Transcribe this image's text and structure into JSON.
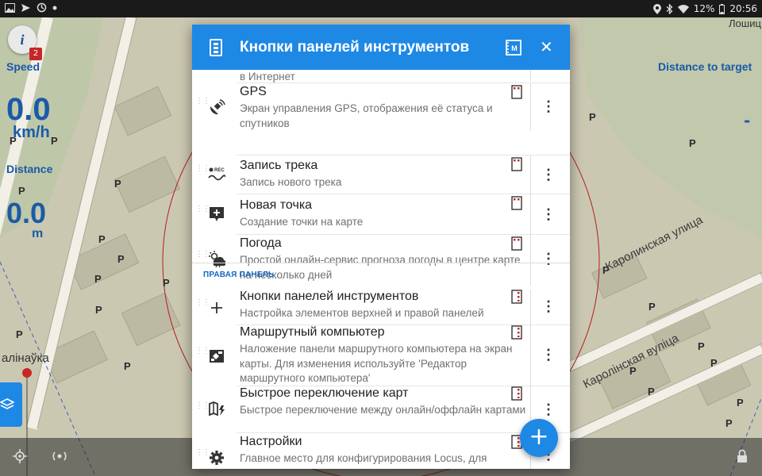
{
  "status_bar": {
    "left_icons": [
      "image-icon",
      "send-icon",
      "sync-icon",
      "dot-icon"
    ],
    "battery": "12%",
    "time": "20:56"
  },
  "map": {
    "speed_label": "Speed",
    "speed_value": "0.0",
    "speed_unit": "km/h",
    "distance_label": "Distance",
    "distance_value": "0.0",
    "distance_unit": "m",
    "distance_to_target_label": "Distance to target",
    "info_badge": "2",
    "info_label": "i",
    "place_label": "алінаўка",
    "street_labels": [
      "Каролинская улица",
      "Каролінская вуліца"
    ],
    "top_label": "Лошиц"
  },
  "dialog": {
    "title": "Кнопки панелей инструментов",
    "top_partial_desc": "в Интернет",
    "section_right_panel": "ПРАВАЯ ПАНЕЛЬ",
    "items_top": [
      {
        "title": "GPS",
        "desc": "Экран управления GPS, отображения её статуса и спутников",
        "icon": "satellite-icon"
      },
      {
        "title": "Запись трека",
        "desc": "Запись нового трека",
        "icon": "track-record-icon"
      },
      {
        "title": "Новая точка",
        "desc": "Создание точки на карте",
        "icon": "add-point-icon"
      },
      {
        "title": "Погода",
        "desc": "Простой онлайн-сервис прогноза погоды в центре карте на несколько дней",
        "icon": "weather-icon"
      }
    ],
    "items_right": [
      {
        "title": "Кнопки панелей инструментов",
        "desc": "Настройка элементов верхней и правой панелей",
        "icon": "plus-icon"
      },
      {
        "title": "Маршрутный компьютер",
        "desc": "Наложение панели маршрутного компьютера на экран карты. Для изменения используйте 'Редактор маршрутного компьютера'",
        "icon": "dashboard-icon"
      },
      {
        "title": "Быстрое переключение карт",
        "desc": "Быстрое переключение между онлайн/оффлайн картами",
        "icon": "map-switch-icon"
      },
      {
        "title": "Настройки",
        "desc": "Главное место для конфигурирования Locus, для",
        "icon": "settings-icon"
      }
    ],
    "more_glyph": "⋮",
    "fab_label": "+"
  },
  "colors": {
    "accent": "#1e88e5",
    "map_text": "#1a5aa8",
    "status_bar": "#1a1a1a"
  }
}
